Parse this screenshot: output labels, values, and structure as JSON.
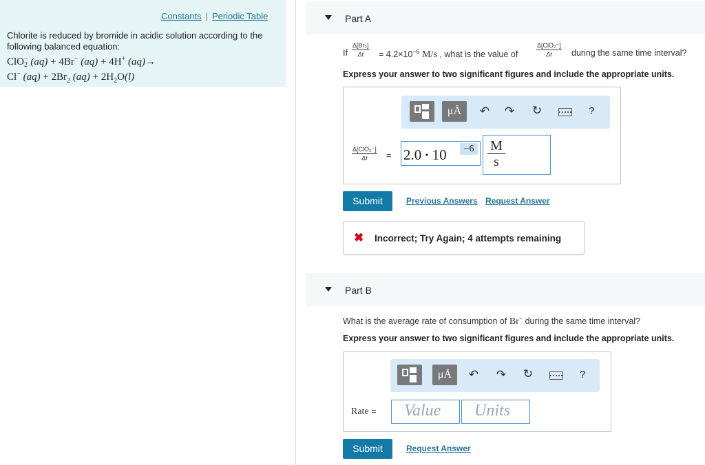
{
  "left_panel": {
    "links": {
      "constants": "Constants",
      "separator": "|",
      "periodic_table": "Periodic Table"
    },
    "intro_text": "Chlorite is reduced by bromide in acidic solution according to the following balanced equation:",
    "equation": {
      "line1": {
        "r1": "ClO",
        "r1_sub": "2",
        "r1_sup": "−",
        "r1_phase": "(aq)",
        "plus": "+",
        "r2": "4Br",
        "r2_sup": "−",
        "r2_phase": "(aq)",
        "r3": "4H",
        "r3_sup": "+",
        "r3_phase": "(aq)",
        "arrow": "→"
      },
      "line2": {
        "p1": "Cl",
        "p1_sup": "−",
        "p1_phase": "(aq)",
        "plus": "+",
        "p2": "2Br",
        "p2_sub": "2",
        "p2_phase": "(aq)",
        "p3": "2H",
        "p3_sub": "2",
        "p3_o": "O",
        "p3_phase": "(l)"
      }
    }
  },
  "part_a": {
    "title": "Part A",
    "question": {
      "if": "If",
      "frac1_num": "Δ[Br₂]",
      "frac1_den": "Δt",
      "equals_value": "= 4.2×10",
      "exp": "−6",
      "units": "M/s",
      "mid": ", what is the value of",
      "frac2_num": "Δ[ClO₂⁻]",
      "frac2_den": "Δt",
      "tail": "during the same time interval?"
    },
    "instructions": "Express your answer to two significant figures and include the appropriate units.",
    "toolbar": {
      "mu_label": "μÅ",
      "undo": "↶",
      "redo": "↷",
      "reset": "↻",
      "help": "?"
    },
    "answer_label_num": "Δ[ClO₂⁻]",
    "answer_label_den": "Δt",
    "answer_label_eq": "=",
    "value": {
      "mantissa": "2.0",
      "dot": "•",
      "base": "10",
      "exponent": "−6"
    },
    "units": {
      "num": "M",
      "den": "s"
    },
    "submit": "Submit",
    "previous_answers": "Previous Answers",
    "request_answer": "Request Answer"
  },
  "feedback": {
    "icon": "✖",
    "message": "Incorrect; Try Again; 4 attempts remaining",
    "color": "#d0021b"
  },
  "part_b": {
    "title": "Part B",
    "question_pre": "What is the average rate of consumption of",
    "question_species": "Br",
    "question_sup": "−",
    "question_post": "during the same time interval?",
    "instructions": "Express your answer to two significant figures and include the appropriate units.",
    "toolbar": {
      "mu_label": "μÅ",
      "undo": "↶",
      "redo": "↷",
      "reset": "↻",
      "help": "?"
    },
    "rate_label": "Rate",
    "rate_eq": "=",
    "value_placeholder": "Value",
    "units_placeholder": "Units",
    "submit": "Submit",
    "request_answer": "Request Answer"
  },
  "colors": {
    "accent": "#127aa6",
    "link": "#26779b",
    "left_bg": "#e5f4f5",
    "toolbar_bg": "#d8eaf7"
  }
}
